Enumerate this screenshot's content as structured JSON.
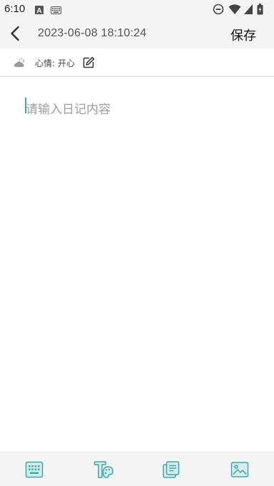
{
  "status_bar": {
    "time": "6:10",
    "left_icons": [
      "a-box-icon",
      "keyboard-icon"
    ],
    "right_icons": [
      "dnd-icon",
      "wifi-icon",
      "signal-icon",
      "battery-icon"
    ]
  },
  "app_bar": {
    "date_time": "2023-06-08 18:10:24",
    "save_label": "保存",
    "back_icon": "chevron-left-icon"
  },
  "mood_bar": {
    "weather_icon": "cloudy-icon",
    "mood_label": "心情: 开心",
    "edit_icon": "pencil-edit-icon"
  },
  "editor": {
    "placeholder": "请输入日记内容",
    "value": ""
  },
  "toolbar": {
    "items": [
      {
        "name": "keyboard-tool",
        "icon": "keyboard-icon"
      },
      {
        "name": "text-style-tool",
        "icon": "text-palette-icon"
      },
      {
        "name": "template-tool",
        "icon": "notes-stack-icon"
      },
      {
        "name": "image-tool",
        "icon": "image-icon"
      }
    ],
    "accent_color": "#3fa7a8"
  }
}
